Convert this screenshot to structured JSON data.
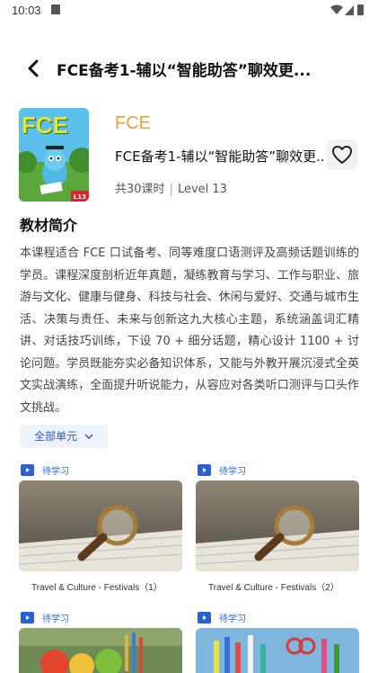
{
  "status": {
    "time": "10:03"
  },
  "nav": {
    "title": "FCE备考1-辅以“智能助答”聊效更..."
  },
  "course": {
    "label": "FCE",
    "name": "FCE备考1-辅以“智能助答”聊效更...",
    "lessons": "共30课时",
    "level": "Level 13",
    "cover_text": "FCE",
    "cover_tag": "L13"
  },
  "intro": {
    "title": "教材简介",
    "text": "本课程适合 FCE 口试备考、同等难度口语测评及高频话题训练的学员。课程深度剖析近年真题，凝练教育与学习、工作与职业、旅游与文化、健康与健身、科技与社会、休闲与爱好、交通与城市生活、决策与责任、未来与创新这九大核心主题，系统涵盖词汇精讲、对话技巧训练，下设 70 + 细分话题，精心设计 1100 + 讨论问题。学员既能夯实必备知识体系，又能与外教开展沉浸式全英文实战演练，全面提升听说能力，从容应对各类听口测评与口头作文挑战。"
  },
  "units_button": {
    "label": "全部单元"
  },
  "lessons": [
    {
      "status": "待学习",
      "title": "Travel & Culture - Festivals（1）"
    },
    {
      "status": "待学习",
      "title": "Travel & Culture - Festivals（2）"
    },
    {
      "status": "待学习",
      "title": ""
    },
    {
      "status": "待学习",
      "title": ""
    }
  ],
  "colors": {
    "accent": "#e9a23b",
    "link_blue": "#2b6fd6",
    "button_bg": "#eef3fb"
  }
}
